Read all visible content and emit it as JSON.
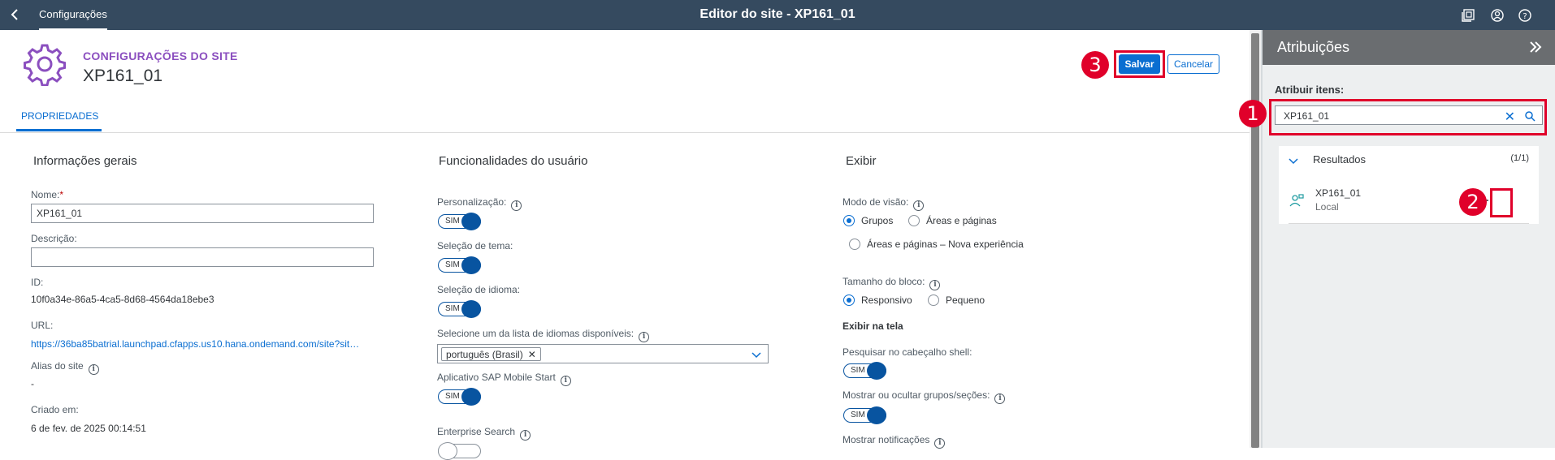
{
  "shell": {
    "breadcrumb": "Configurações",
    "title": "Editor do site - XP161_01"
  },
  "header": {
    "kicker": "CONFIGURAÇÕES DO SITE",
    "site_name": "XP161_01",
    "save_label": "Salvar",
    "cancel_label": "Cancelar"
  },
  "tabs": [
    {
      "label": "PROPRIEDADES",
      "selected": true
    }
  ],
  "general": {
    "heading": "Informações gerais",
    "name_label": "Nome:",
    "name_required": "*",
    "name_value": "XP161_01",
    "description_label": "Descrição:",
    "description_value": "",
    "id_label": "ID:",
    "id_value": "10f0a34e-86a5-4ca5-8d68-4564da18ebe3",
    "url_label": "URL:",
    "url_value": "https://36ba85batrial.launchpad.cfapps.us10.hana.ondemand.com/site?sit…",
    "alias_label": "Alias do site",
    "alias_value": "-",
    "created_label": "Criado em:",
    "created_value": "6 de fev. de 2025 00:14:51"
  },
  "user_features": {
    "heading": "Funcionalidades do usuário",
    "personalization_label": "Personalização:",
    "theme_label": "Seleção de tema:",
    "language_label": "Seleção de idioma:",
    "language_list_label": "Selecione um da lista de idiomas disponíveis:",
    "language_token": "português (Brasil)",
    "mobile_start_label": "Aplicativo SAP Mobile Start",
    "enterprise_search_label": "Enterprise Search",
    "toggle_on_text": "SIM"
  },
  "display": {
    "heading": "Exibir",
    "view_mode_label": "Modo de visão:",
    "view_modes": [
      "Grupos",
      "Áreas e páginas",
      "Áreas e páginas – Nova experiência"
    ],
    "view_mode_selected": "Grupos",
    "tile_size_label": "Tamanho do bloco:",
    "tile_sizes": [
      "Responsivo",
      "Pequeno"
    ],
    "tile_size_selected": "Responsivo",
    "on_screen_heading": "Exibir na tela",
    "shell_search_label": "Pesquisar no cabeçalho shell:",
    "show_hide_groups_label": "Mostrar ou ocultar grupos/seções:",
    "notifications_label": "Mostrar notificações"
  },
  "panel": {
    "title": "Atribuições",
    "assign_label": "Atribuir itens:",
    "search_value": "XP161_01",
    "results_label": "Resultados",
    "results_count": "(1/1)",
    "result_item": {
      "name": "XP161_01",
      "source": "Local"
    }
  },
  "annotations": {
    "badge1": "1",
    "badge2": "2",
    "badge3": "3",
    "color": "#e0002a"
  },
  "colors": {
    "shell": "#354a5f",
    "accent": "#0a6ed1",
    "kicker": "#8b4fbf"
  }
}
